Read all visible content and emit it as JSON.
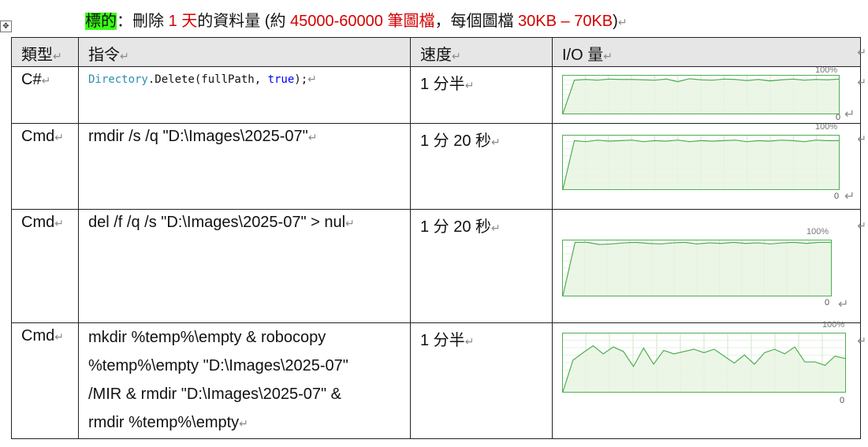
{
  "title": {
    "highlight": "標的",
    "colon_text": "：刪除 ",
    "red1": "1 天",
    "mid_text": "的資料量 (約 ",
    "red2": "45000-60000 筆圖檔",
    "mid2_text": "，每個圖檔 ",
    "red3": "30KB – 70KB",
    "end_text": ")"
  },
  "return_mark": "↵",
  "table": {
    "headers": [
      "類型",
      "指令",
      "速度",
      "I/O 量"
    ],
    "rows": [
      {
        "type": "C#",
        "command_parts": {
          "cls": "Directory",
          "call": ".Delete(fullPath, ",
          "bool": "true",
          "end": ");"
        },
        "speed": "1 分半",
        "pct_label": "100%",
        "zero_label": "0"
      },
      {
        "type": "Cmd",
        "command": "rmdir /s /q \"D:\\Images\\2025-07\"",
        "speed": "1 分 20 秒",
        "pct_label": "100%",
        "zero_label": "0"
      },
      {
        "type": "Cmd",
        "command": "del /f /q /s \"D:\\Images\\2025-07\" > nul",
        "speed": "1 分 20 秒",
        "pct_label": "100%",
        "zero_label": "0"
      },
      {
        "type": "Cmd",
        "command_lines": [
          "mkdir %temp%\\empty & robocopy",
          "%temp%\\empty \"D:\\Images\\2025-07\"",
          "/MIR & rmdir \"D:\\Images\\2025-07\" &",
          "rmdir %temp%\\empty"
        ],
        "speed": "1 分半",
        "pct_label": "100%",
        "zero_label": "0"
      }
    ]
  },
  "graphs": [
    {
      "io_percent": [
        0,
        90,
        92,
        90,
        93,
        92,
        92,
        91,
        90,
        93,
        86,
        94,
        91,
        90,
        93,
        92,
        89,
        92,
        88,
        91,
        93,
        90,
        92,
        91,
        93
      ]
    },
    {
      "io_percent": [
        0,
        92,
        90,
        93,
        91,
        92,
        93,
        90,
        92,
        91,
        93,
        90,
        92,
        91,
        92,
        93,
        90,
        92,
        91,
        93,
        92,
        90,
        93,
        92,
        92
      ]
    },
    {
      "io_percent": [
        0,
        98,
        98,
        94,
        95,
        97,
        98,
        96,
        95,
        97,
        98,
        95,
        97,
        96,
        98,
        96,
        97,
        95,
        97,
        98,
        96,
        98,
        98
      ]
    },
    {
      "io_percent": [
        0,
        55,
        68,
        80,
        66,
        78,
        70,
        44,
        76,
        48,
        72,
        66,
        70,
        74,
        68,
        74,
        62,
        50,
        64,
        48,
        68,
        74,
        66,
        78,
        52,
        52,
        46,
        62,
        58
      ]
    }
  ],
  "colors": {
    "graph_line": "#4caf50",
    "graph_fill": "#e9f5e3",
    "graph_grid": "#cfe5c8",
    "highlight": "#39ff14",
    "red": "#d40000"
  }
}
